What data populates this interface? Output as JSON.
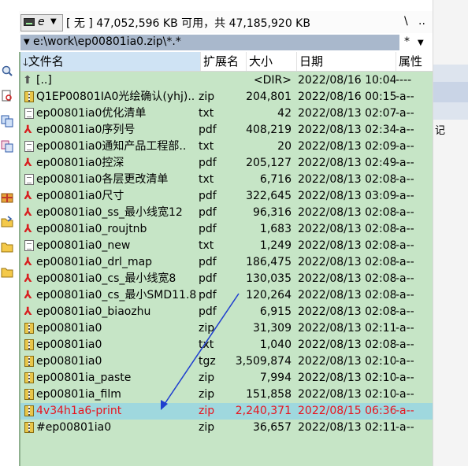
{
  "drive": {
    "letter": "e",
    "info": "[ 无 ]  47,052,596 KB 可用，共 47,185,920 KB",
    "root_label": "\\",
    "up_label": ".."
  },
  "path": {
    "value": "e:\\work\\ep00801ia0.zip\\*.*",
    "filter_label": "*"
  },
  "columns": {
    "name": "文件名",
    "ext": "扩展名",
    "size": "大小",
    "date": "日期",
    "attr": "属性"
  },
  "right_pane": {
    "text": "记"
  },
  "files": [
    {
      "name": "[..]",
      "ext": "",
      "size": "<DIR>",
      "date": "2022/08/16 10:04",
      "attr": "----",
      "icon": "up-icon"
    },
    {
      "name": "Q1EP00801IA0光绘确认(yhj)..",
      "ext": "zip",
      "size": "204,801",
      "date": "2022/08/16 00:15",
      "attr": "-a--",
      "icon": "zip-icon"
    },
    {
      "name": "ep00801ia0优化清单",
      "ext": "txt",
      "size": "42",
      "date": "2022/08/13 02:07",
      "attr": "-a--",
      "icon": "txt-icon"
    },
    {
      "name": "ep00801ia0序列号",
      "ext": "pdf",
      "size": "408,219",
      "date": "2022/08/13 02:34",
      "attr": "-a--",
      "icon": "pdf-icon"
    },
    {
      "name": "ep00801ia0通知产品工程部..",
      "ext": "txt",
      "size": "20",
      "date": "2022/08/13 02:09",
      "attr": "-a--",
      "icon": "txt-icon"
    },
    {
      "name": "ep00801ia0控深",
      "ext": "pdf",
      "size": "205,127",
      "date": "2022/08/13 02:49",
      "attr": "-a--",
      "icon": "pdf-icon"
    },
    {
      "name": "ep00801ia0各层更改清单",
      "ext": "txt",
      "size": "6,716",
      "date": "2022/08/13 02:08",
      "attr": "-a--",
      "icon": "txt-icon"
    },
    {
      "name": "ep00801ia0尺寸",
      "ext": "pdf",
      "size": "322,645",
      "date": "2022/08/13 03:09",
      "attr": "-a--",
      "icon": "pdf-icon"
    },
    {
      "name": "ep00801ia0_ss_最小线宽12",
      "ext": "pdf",
      "size": "96,316",
      "date": "2022/08/13 02:08",
      "attr": "-a--",
      "icon": "pdf-icon"
    },
    {
      "name": "ep00801ia0_roujtnb",
      "ext": "pdf",
      "size": "1,683",
      "date": "2022/08/13 02:08",
      "attr": "-a--",
      "icon": "pdf-icon"
    },
    {
      "name": "ep00801ia0_new",
      "ext": "txt",
      "size": "1,249",
      "date": "2022/08/13 02:08",
      "attr": "-a--",
      "icon": "txt-icon"
    },
    {
      "name": "ep00801ia0_drl_map",
      "ext": "pdf",
      "size": "186,475",
      "date": "2022/08/13 02:08",
      "attr": "-a--",
      "icon": "pdf-icon"
    },
    {
      "name": "ep00801ia0_cs_最小线宽8",
      "ext": "pdf",
      "size": "130,035",
      "date": "2022/08/13 02:08",
      "attr": "-a--",
      "icon": "pdf-icon"
    },
    {
      "name": "ep00801ia0_cs_最小SMD11.8",
      "ext": "pdf",
      "size": "120,264",
      "date": "2022/08/13 02:08",
      "attr": "-a--",
      "icon": "pdf-icon"
    },
    {
      "name": "ep00801ia0_biaozhu",
      "ext": "pdf",
      "size": "6,915",
      "date": "2022/08/13 02:08",
      "attr": "-a--",
      "icon": "pdf-icon"
    },
    {
      "name": "ep00801ia0",
      "ext": "zip",
      "size": "31,309",
      "date": "2022/08/13 02:11",
      "attr": "-a--",
      "icon": "zip-icon"
    },
    {
      "name": "ep00801ia0",
      "ext": "txt",
      "size": "1,040",
      "date": "2022/08/13 02:08",
      "attr": "-a--",
      "icon": "zip-icon"
    },
    {
      "name": "ep00801ia0",
      "ext": "tgz",
      "size": "3,509,874",
      "date": "2022/08/13 02:10",
      "attr": "-a--",
      "icon": "zip-icon"
    },
    {
      "name": "ep00801ia_paste",
      "ext": "zip",
      "size": "7,994",
      "date": "2022/08/13 02:10",
      "attr": "-a--",
      "icon": "zip-icon"
    },
    {
      "name": "ep00801ia_film",
      "ext": "zip",
      "size": "151,858",
      "date": "2022/08/13 02:10",
      "attr": "-a--",
      "icon": "zip-icon"
    },
    {
      "name": "4v34h1a6-print",
      "ext": "zip",
      "size": "2,240,371",
      "date": "2022/08/15 06:36",
      "attr": "-a--",
      "icon": "zip-icon",
      "selected": true
    },
    {
      "name": "#ep00801ia0",
      "ext": "zip",
      "size": "36,657",
      "date": "2022/08/13 02:11",
      "attr": "-a--",
      "icon": "zip-icon"
    }
  ],
  "colors": {
    "panel_bg": "#c6e5c6",
    "selected_row_bg": "#9fd8de",
    "selected_text": "#e8141e",
    "path_bg": "#a9b8cc",
    "arrow": "#1f3fcf"
  }
}
